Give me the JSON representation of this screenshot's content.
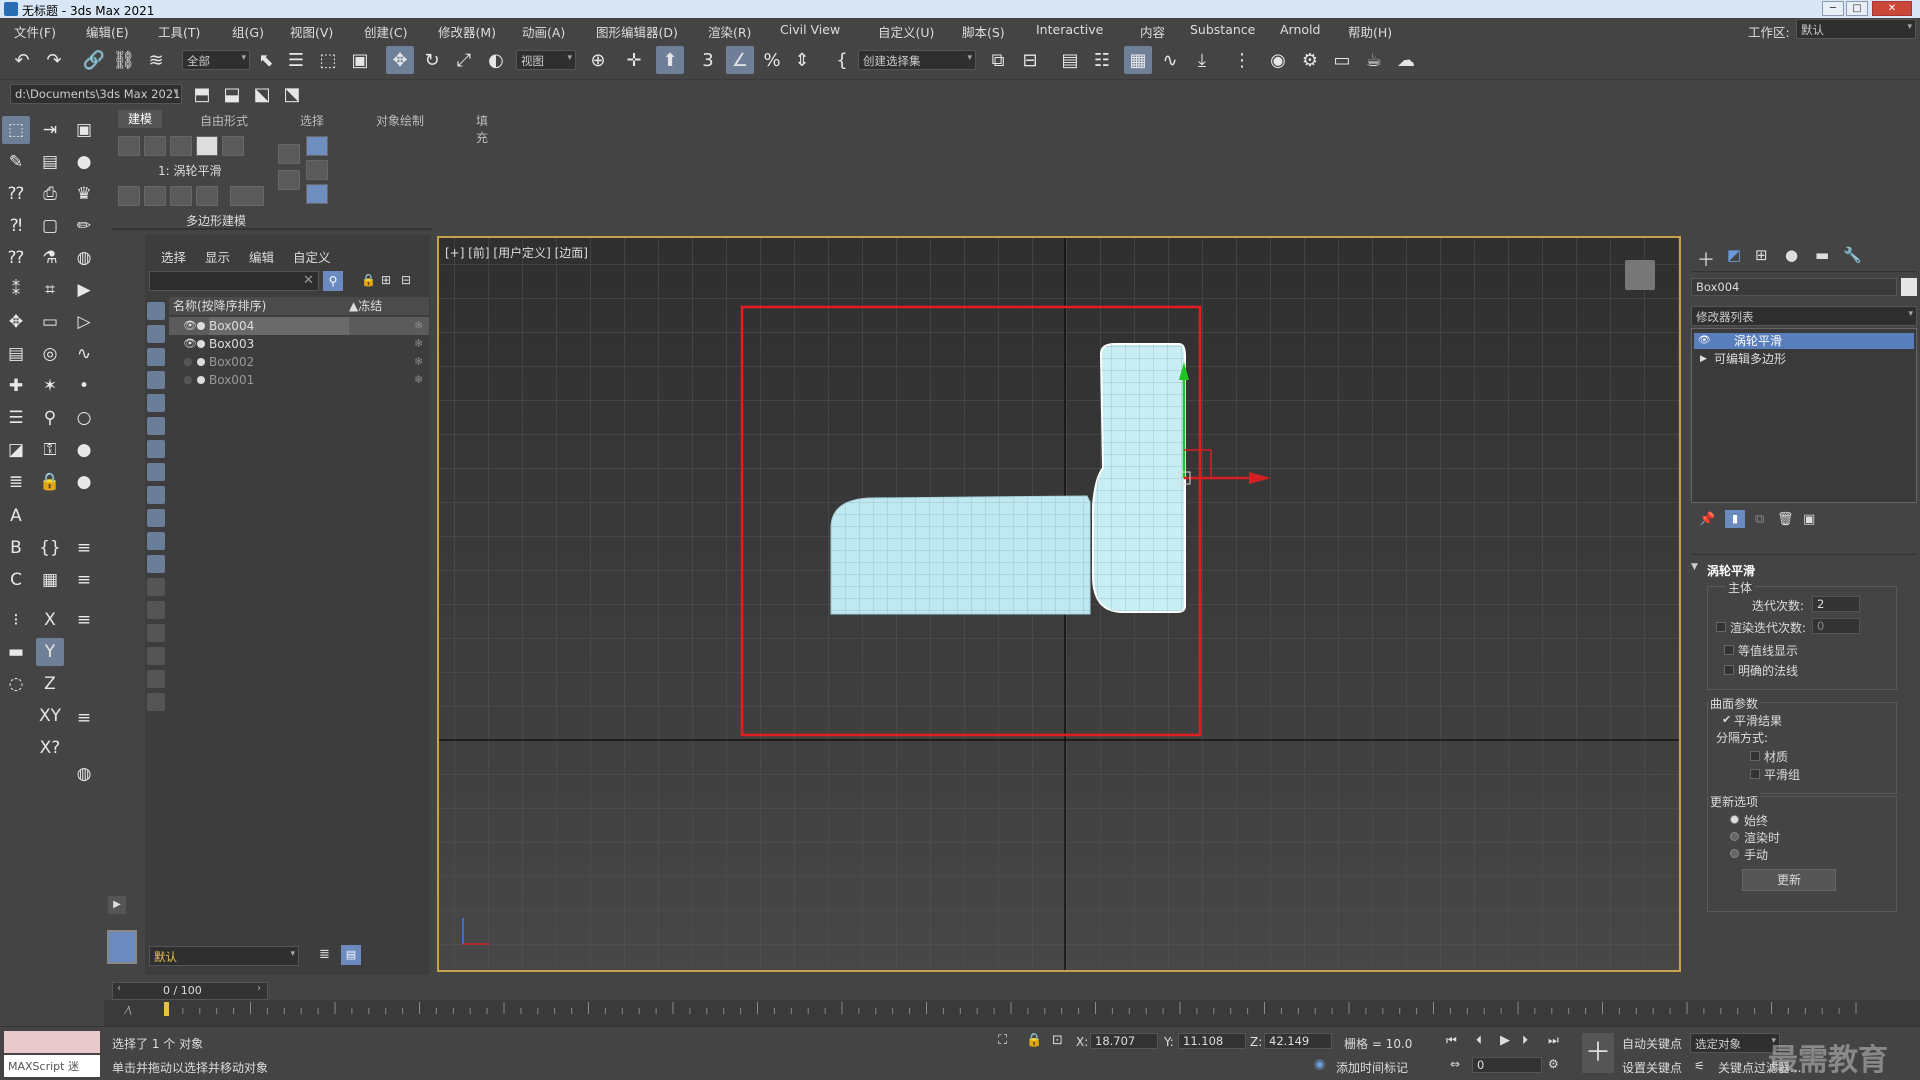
{
  "window": {
    "title": "无标题 - 3ds Max 2021"
  },
  "menu": [
    "文件(F)",
    "编辑(E)",
    "工具(T)",
    "组(G)",
    "视图(V)",
    "创建(C)",
    "修改器(M)",
    "动画(A)",
    "图形编辑器(D)",
    "渲染(R)",
    "Civil View",
    "自定义(U)",
    "脚本(S)",
    "Interactive",
    "内容",
    "Substance",
    "Arnold",
    "帮助(H)"
  ],
  "workspace": {
    "label": "工作区:",
    "value": "默认"
  },
  "toolbar": {
    "filter_value": "全部",
    "coord_value": "视图",
    "selection_set_placeholder": "创建选择集"
  },
  "project_path": "d:\\Documents\\3ds Max 2021",
  "ribbon": {
    "tabs": [
      "建模",
      "自由形式",
      "选择",
      "对象绘制",
      "填充"
    ],
    "active_tab": "建模",
    "modifier_label": "1: 涡轮平滑",
    "section_label": "多边形建模"
  },
  "scene_explorer": {
    "menu": [
      "选择",
      "显示",
      "编辑",
      "自定义"
    ],
    "col_name": "名称(按降序排序)",
    "col_freeze": "▲冻结",
    "rows": [
      {
        "name": "Box004",
        "visible": true,
        "selected": true
      },
      {
        "name": "Box003",
        "visible": true,
        "selected": false
      },
      {
        "name": "Box002",
        "visible": false,
        "selected": false
      },
      {
        "name": "Box001",
        "visible": false,
        "selected": false
      }
    ],
    "layer_value": "默认"
  },
  "viewport": {
    "label": "[+] [前] [用户定义] [边面]"
  },
  "command_panel": {
    "object_name": "Box004",
    "modifier_list_label": "修改器列表",
    "stack": [
      "涡轮平滑",
      "可编辑多边形"
    ],
    "rollout_title": "涡轮平滑",
    "main_group": "主体",
    "iterations_label": "迭代次数:",
    "iterations_value": "2",
    "render_iter_label": "渲染迭代次数:",
    "render_iter_value": "0",
    "isoline_label": "等值线显示",
    "explicit_normals_label": "明确的法线",
    "surface_group": "曲面参数",
    "smooth_result_label": "平滑结果",
    "separate_label": "分隔方式:",
    "material_label": "材质",
    "smooth_group_label": "平滑组",
    "update_group": "更新选项",
    "always_label": "始终",
    "render_time_label": "渲染时",
    "manual_label": "手动",
    "update_button": "更新"
  },
  "timeline": {
    "frame_display": "0 / 100",
    "ticks": [
      "0",
      "5",
      "10",
      "15",
      "20",
      "25",
      "30",
      "35",
      "40",
      "45",
      "50",
      "55",
      "60",
      "65",
      "70",
      "75",
      "80",
      "85",
      "90",
      "95",
      "100"
    ]
  },
  "status": {
    "maxscript_label": "MAXScript 迷",
    "selected_text": "选择了 1 个 对象",
    "prompt_text": "单击并拖动以选择并移动对象",
    "x_label": "X:",
    "x_value": "18.707",
    "y_label": "Y:",
    "y_value": "11.108",
    "z_label": "Z:",
    "z_value": "42.149",
    "grid_text": "栅格 = 10.0",
    "add_time_tag": "添加时间标记",
    "auto_key": "自动关键点",
    "set_key": "设置关键点",
    "selected_obj": "选定对象",
    "key_filter": "关键点过滤器...",
    "frame_value": "0",
    "watermark": "最需教育"
  }
}
